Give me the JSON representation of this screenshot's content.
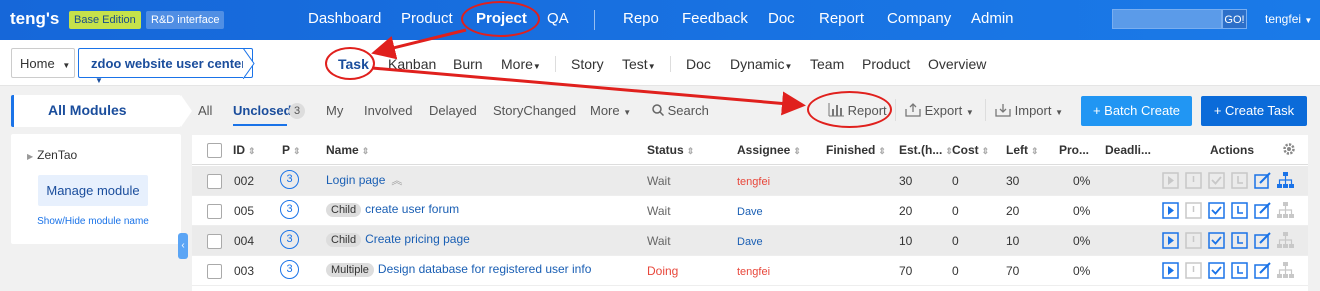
{
  "topnav": {
    "brand": "teng's",
    "edition_tag": "Base Edition",
    "rd_tag": "R&D interface",
    "items": [
      "Dashboard",
      "Product",
      "Project",
      "QA",
      "Repo",
      "Feedback",
      "Doc",
      "Report",
      "Company",
      "Admin"
    ],
    "active_item": "Project",
    "search_button": "GO!",
    "user": "tengfei"
  },
  "subnav": {
    "home": "Home",
    "project": "zdoo website user center",
    "items": [
      "Task",
      "Kanban",
      "Burn",
      "More",
      "Story",
      "Test",
      "Doc",
      "Dynamic",
      "Team",
      "Product",
      "Overview"
    ],
    "active_item": "Task"
  },
  "sidebar": {
    "title": "All Modules",
    "tree_root": "ZenTao",
    "manage_button": "Manage module",
    "toggle_link": "Show/Hide module name"
  },
  "filters": {
    "all": "All",
    "unclosed": "Unclosed",
    "unclosed_count": "3",
    "my": "My",
    "involved": "Involved",
    "delayed": "Delayed",
    "story_changed": "StoryChanged",
    "more": "More",
    "search": "Search"
  },
  "toolbar": {
    "report": "Report",
    "export": "Export",
    "import": "Import",
    "batch_create": "+ Batch Create",
    "create_task": "+ Create Task"
  },
  "table": {
    "headers": {
      "id": "ID",
      "pri": "P",
      "name": "Name",
      "status": "Status",
      "assignee": "Assignee",
      "finished": "Finished",
      "estimate": "Est.(h...",
      "cost": "Cost",
      "left": "Left",
      "progress": "Pro...",
      "deadline": "Deadli...",
      "actions": "Actions"
    },
    "rows": [
      {
        "id": "002",
        "pri": "3",
        "label": "",
        "name": "Login page",
        "status": "Wait",
        "assignee": "tengfei",
        "est": "30",
        "cost": "0",
        "left": "30",
        "progress": "0%"
      },
      {
        "id": "005",
        "pri": "3",
        "label": "Child",
        "name": "create user forum",
        "status": "Wait",
        "assignee": "Dave",
        "est": "20",
        "cost": "0",
        "left": "20",
        "progress": "0%"
      },
      {
        "id": "004",
        "pri": "3",
        "label": "Child",
        "name": "Create pricing page",
        "status": "Wait",
        "assignee": "Dave",
        "est": "10",
        "cost": "0",
        "left": "10",
        "progress": "0%"
      },
      {
        "id": "003",
        "pri": "3",
        "label": "Multiple",
        "name": "Design database for registered user info",
        "status": "Doing",
        "assignee": "tengfei",
        "est": "70",
        "cost": "0",
        "left": "70",
        "progress": "0%"
      }
    ]
  },
  "colors": {
    "primary": "#1a73e8",
    "annotation": "#e0201d",
    "doing": "#e8473b"
  }
}
